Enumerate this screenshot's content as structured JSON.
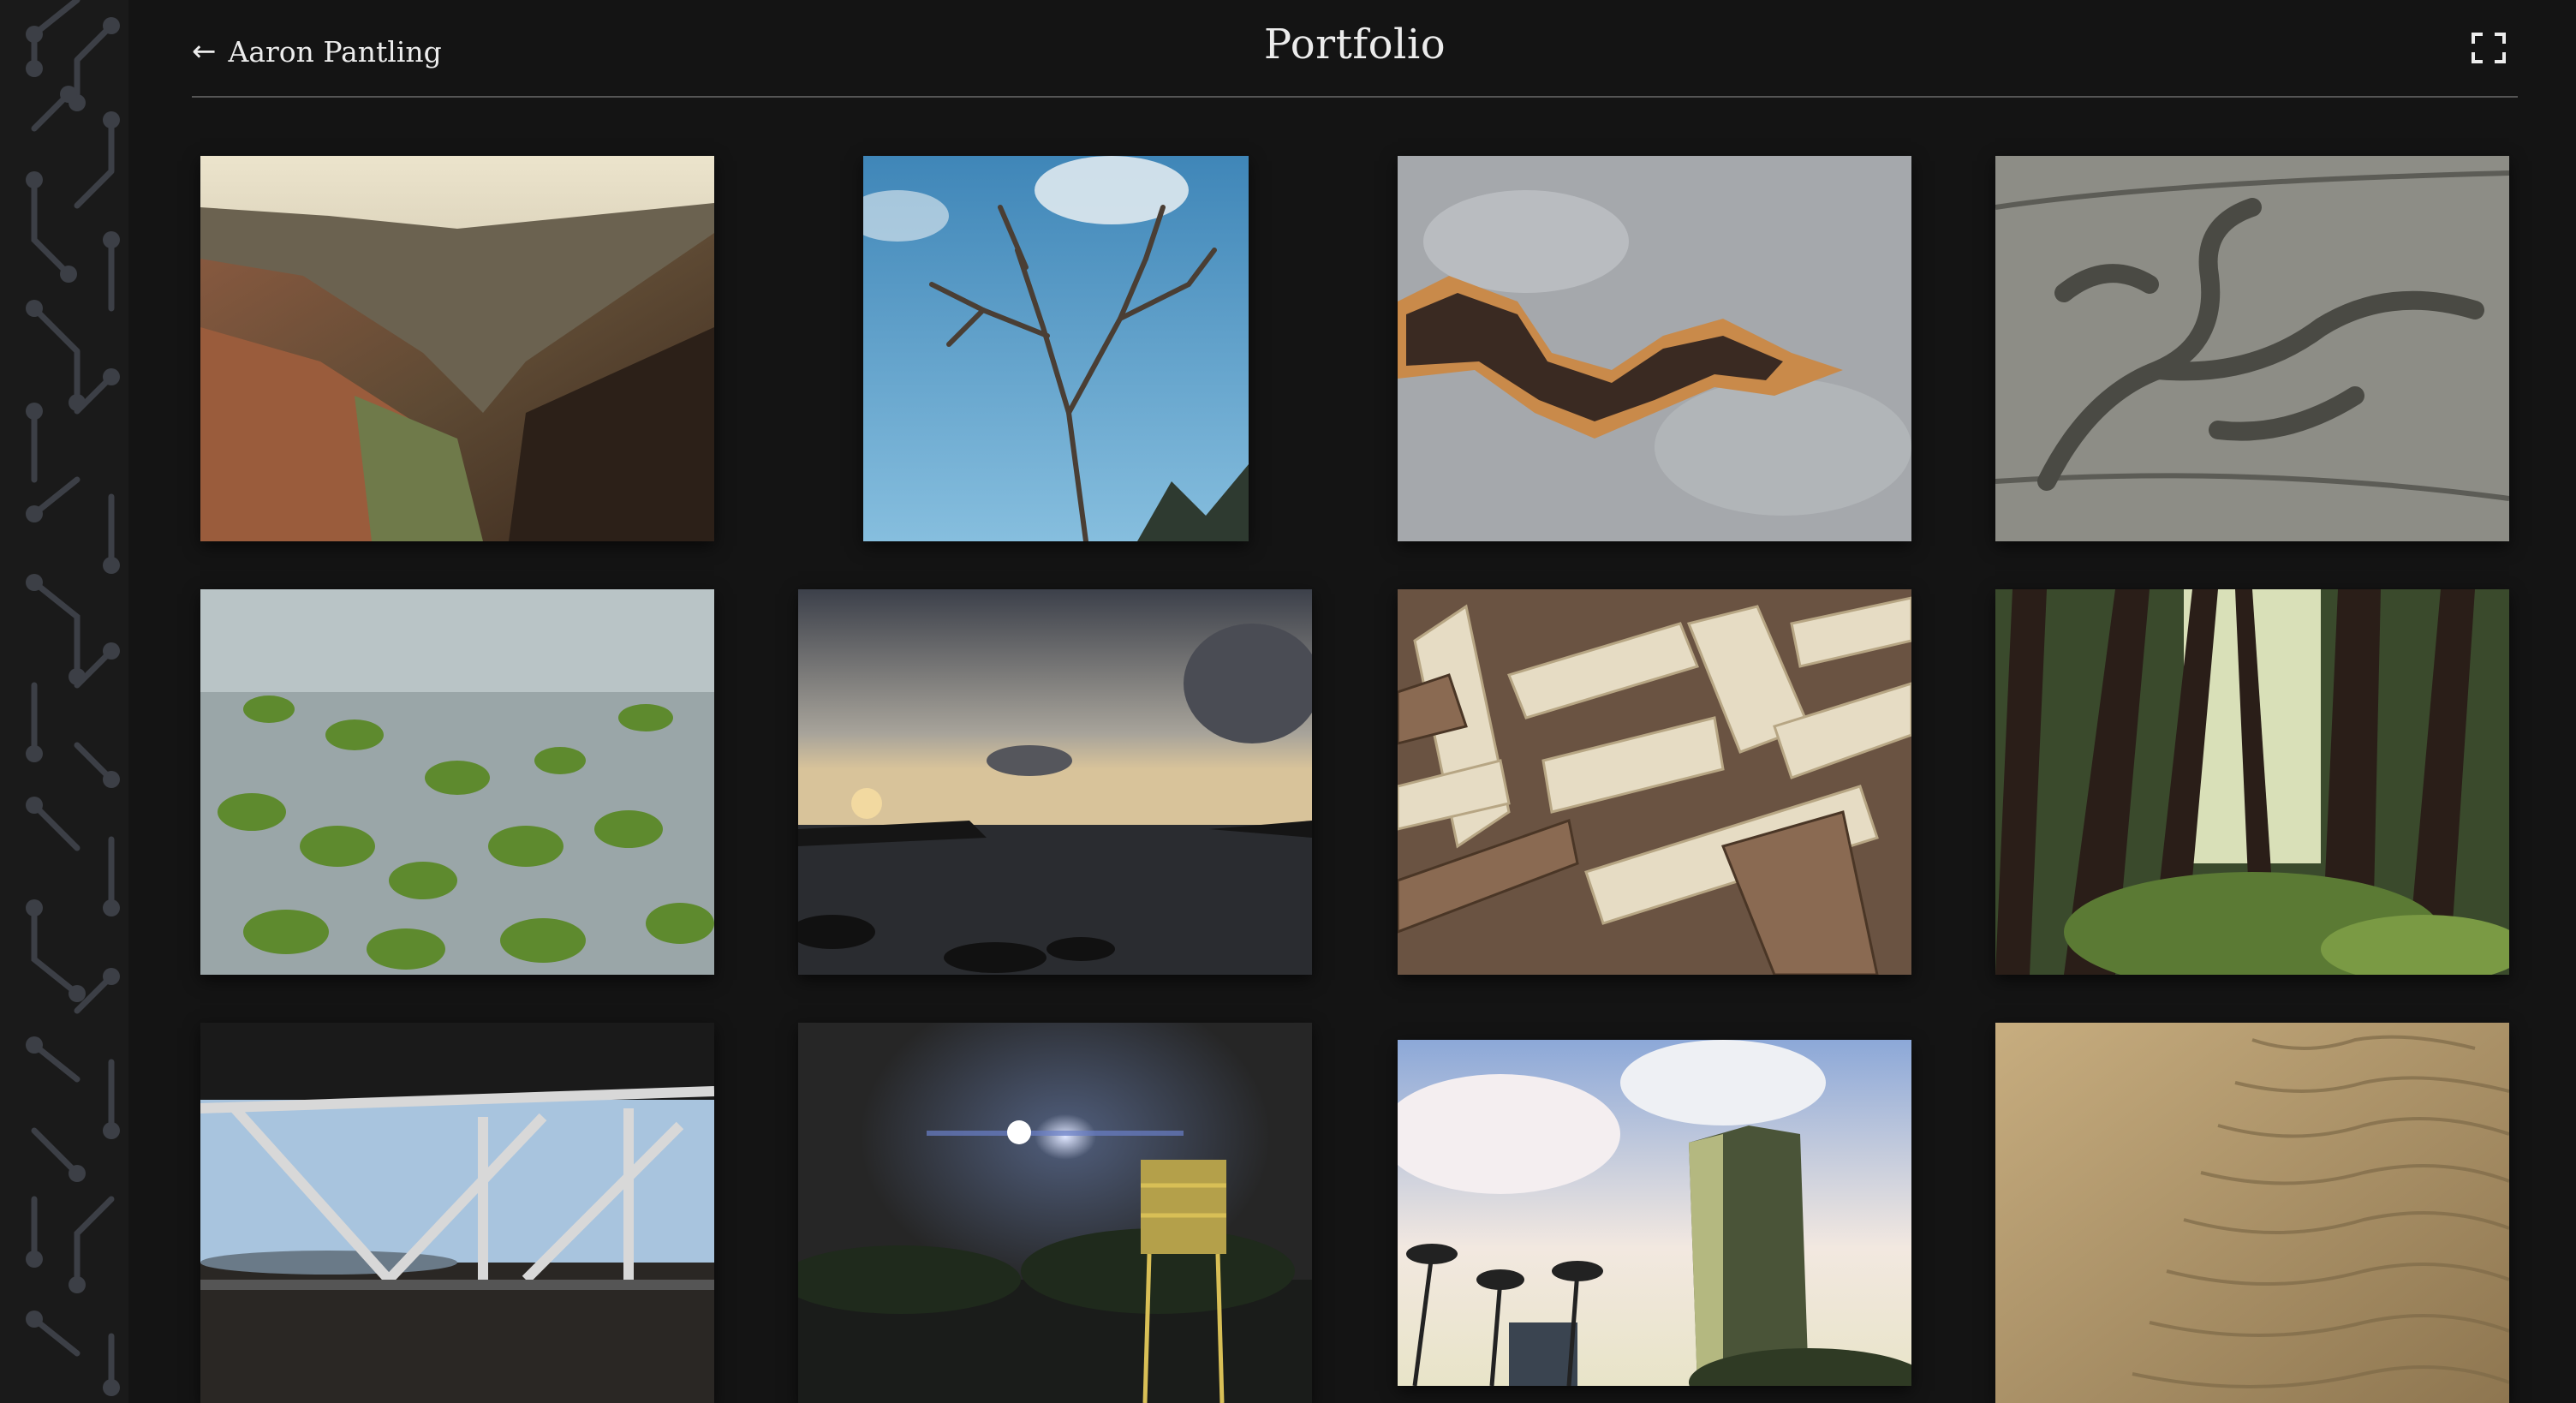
{
  "header": {
    "back_arrow": "←",
    "back_label": "Aaron Pantling",
    "title": "Portfolio",
    "fullscreen_icon": "fullscreen-icon"
  },
  "gallery": {
    "photos": [
      {
        "subject": "canyon",
        "icon": "photo-canyon"
      },
      {
        "subject": "bare tree against sky",
        "icon": "photo-tree"
      },
      {
        "subject": "rusted metal",
        "icon": "photo-rust"
      },
      {
        "subject": "weathered wood",
        "icon": "photo-wood"
      },
      {
        "subject": "mossy rocks in water",
        "icon": "photo-moss"
      },
      {
        "subject": "ocean sunset",
        "icon": "photo-ocean"
      },
      {
        "subject": "wood lattice",
        "icon": "photo-lattice"
      },
      {
        "subject": "redwood forest",
        "icon": "photo-forest"
      },
      {
        "subject": "bridge structure",
        "icon": "photo-bridge"
      },
      {
        "subject": "water tower at night",
        "icon": "photo-tower"
      },
      {
        "subject": "palm trees and high-rise",
        "icon": "photo-building"
      },
      {
        "subject": "sand ripples",
        "icon": "photo-sand"
      }
    ]
  },
  "colors": {
    "background": "#141414",
    "deco_background": "#1a1a1a",
    "deco_lines": "#3c3f46",
    "text": "#ececec",
    "divider": "#555555"
  }
}
